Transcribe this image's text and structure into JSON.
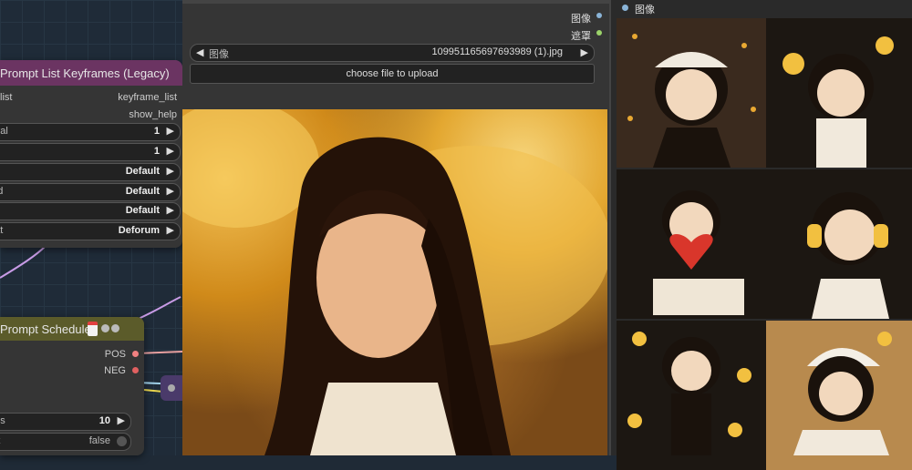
{
  "prompt_list_node": {
    "title": "Prompt List Keyframes (Legacy)",
    "input_label": "list",
    "outputs": [
      "keyframe_list",
      "show_help"
    ],
    "widgets": [
      {
        "label": "erval",
        "value": "1"
      },
      {
        "label": "",
        "value": "1"
      },
      {
        "label": "e",
        "value": "Default"
      },
      {
        "label": "eed",
        "value": "Default"
      },
      {
        "label": "file",
        "value": "Default"
      },
      {
        "label": "mat",
        "value": "Deforum"
      }
    ],
    "colors": {
      "title_bar": "#6b3462"
    }
  },
  "prompt_schedule_node": {
    "title": "Prompt Schedule",
    "outputs": [
      "POS",
      "NEG"
    ],
    "widgets": [
      {
        "label": "mes",
        "value": "10"
      },
      {
        "label": "put",
        "value": "false"
      }
    ],
    "colors": {
      "title_bar": "#5b5b2a"
    }
  },
  "load_image_node": {
    "outputs": [
      "图像",
      "遮罩"
    ],
    "image_combo_label": "图像",
    "image_combo_value": "109951165697693989 (1).jpg",
    "upload_label": "choose file to upload"
  },
  "preview_node": {
    "input_label": "图像"
  },
  "colors": {
    "pos_port": "#f08080",
    "neg_port": "#e06060",
    "mask_port": "#9bd36a",
    "image_port": "#8ab4d8",
    "link_purple": "#c89be6",
    "link_yellow": "#e8d44d"
  }
}
